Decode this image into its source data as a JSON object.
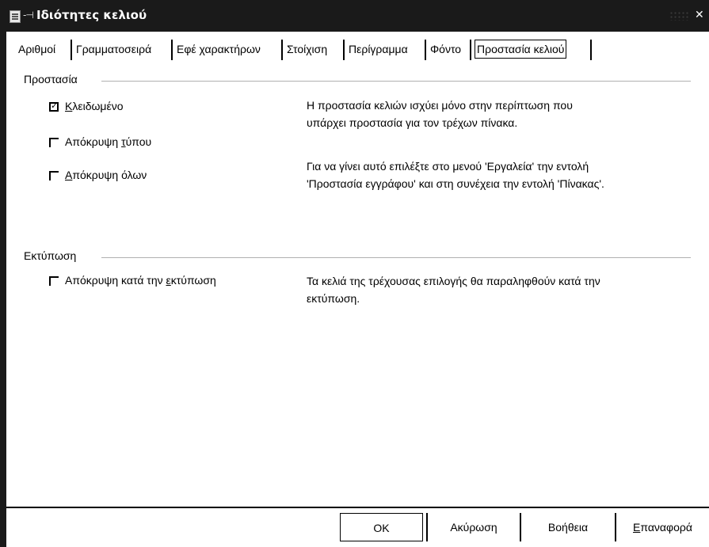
{
  "window": {
    "title": "Ιδιότητες κελιού",
    "close_glyph": "✕",
    "pin_glyph": "-⊣"
  },
  "tabs": [
    {
      "label": "Αριθμοί",
      "active": false
    },
    {
      "label": "Γραμματοσειρά",
      "active": false
    },
    {
      "label": "Εφέ χαρακτήρων",
      "active": false
    },
    {
      "label": "Στοίχιση",
      "active": false
    },
    {
      "label": "Περίγραμμα",
      "active": false
    },
    {
      "label": "Φόντο",
      "active": false
    },
    {
      "label": "Προστασία κελιού",
      "active": true
    }
  ],
  "protection": {
    "header": "Προστασία",
    "locked": {
      "pre": "",
      "key": "Κ",
      "post": "λειδωμένο",
      "checked": true
    },
    "hide_formula": {
      "pre": "Απόκρυψη ",
      "key": "τ",
      "post": "ύπου",
      "checked": false
    },
    "hide_all": {
      "pre": "",
      "key": "Α",
      "post": "πόκρυψη όλων",
      "checked": false
    },
    "desc_line1": "Η προστασία κελιών ισχύει μόνο στην περίπτωση που",
    "desc_line2": "υπάρχει προστασία για τον τρέχων πίνακα.",
    "desc_line3": "Για να γίνει αυτό επιλέξτε στο μενού 'Εργαλεία' την εντολή",
    "desc_line4": "'Προστασία εγγράφου' και στη συνέχεια την εντολή 'Πίνακας'."
  },
  "print": {
    "header": "Εκτύπωση",
    "hide_when_printing": {
      "pre": "Απόκρυψη κατά την ",
      "key": "ε",
      "post": "κτύπωση",
      "checked": false
    },
    "desc_line1": "Τα κελιά της τρέχουσας επιλογής θα παραληφθούν κατά την",
    "desc_line2": "εκτύπωση."
  },
  "buttons": {
    "ok": "ΟΚ",
    "cancel": "Ακύρωση",
    "help": "Βοήθεια",
    "reset_key": "Ε",
    "reset_rest": "παναφορά"
  },
  "checkmark_glyph": "✓"
}
